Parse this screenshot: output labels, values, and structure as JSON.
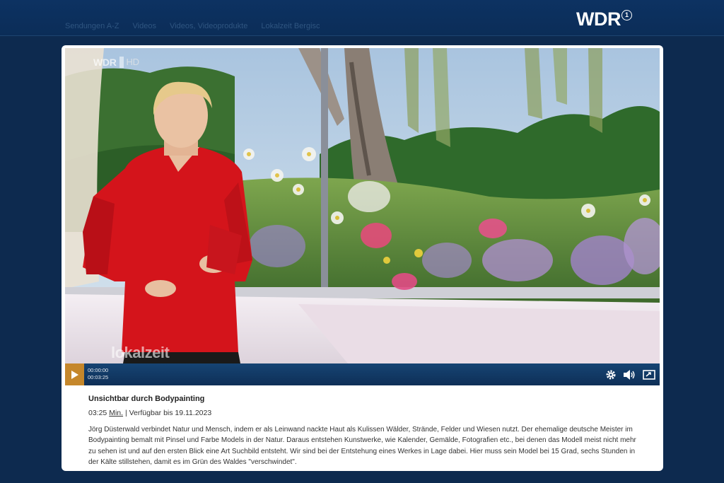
{
  "header": {
    "breadcrumb": [
      "Sendungen A-Z",
      "Videos",
      "Videos, Videoprodukte",
      "Lokalzeit Bergisch Land"
    ],
    "logo_text": "WDR",
    "logo_badge": "1"
  },
  "video": {
    "watermark_channel": "WDR",
    "watermark_quality": "HD",
    "watermark_show": "lokalzeit",
    "scene": "presenter-in-red-shirt-meadow-backdrop"
  },
  "player": {
    "play_icon": "play-icon",
    "current_time": "00:00:00",
    "total_time": "00:03:25",
    "settings_icon": "gear-icon",
    "volume_icon": "speaker-icon",
    "fullscreen_icon": "fullscreen-icon",
    "progress": 0,
    "accent_color": "#c5872b"
  },
  "info": {
    "title": "Unsichtbar durch Bodypainting",
    "duration": "03:25",
    "duration_unit": "Min.",
    "availability": "| Verfügbar bis 19.11.2023",
    "description": "Jörg Düsterwald verbindet Natur und Mensch, indem er als Leinwand nackte Haut als Kulissen Wälder, Strände, Felder und Wiesen nutzt. Der ehemalige deutsche Meister im Bodypainting bemalt mit Pinsel und Farbe Models in der Natur. Daraus entstehen Kunstwerke, wie Kalender, Gemälde, Fotografien etc., bei denen das Modell meist nicht mehr zu sehen ist und auf den ersten Blick eine Art Suchbild entsteht. Wir sind bei der Entstehung eines Werkes in Lage dabei. Hier muss sein Model bei 15 Grad, sechs Stunden in der Kälte stillstehen, damit es im Grün des Waldes \"verschwindet\"."
  }
}
